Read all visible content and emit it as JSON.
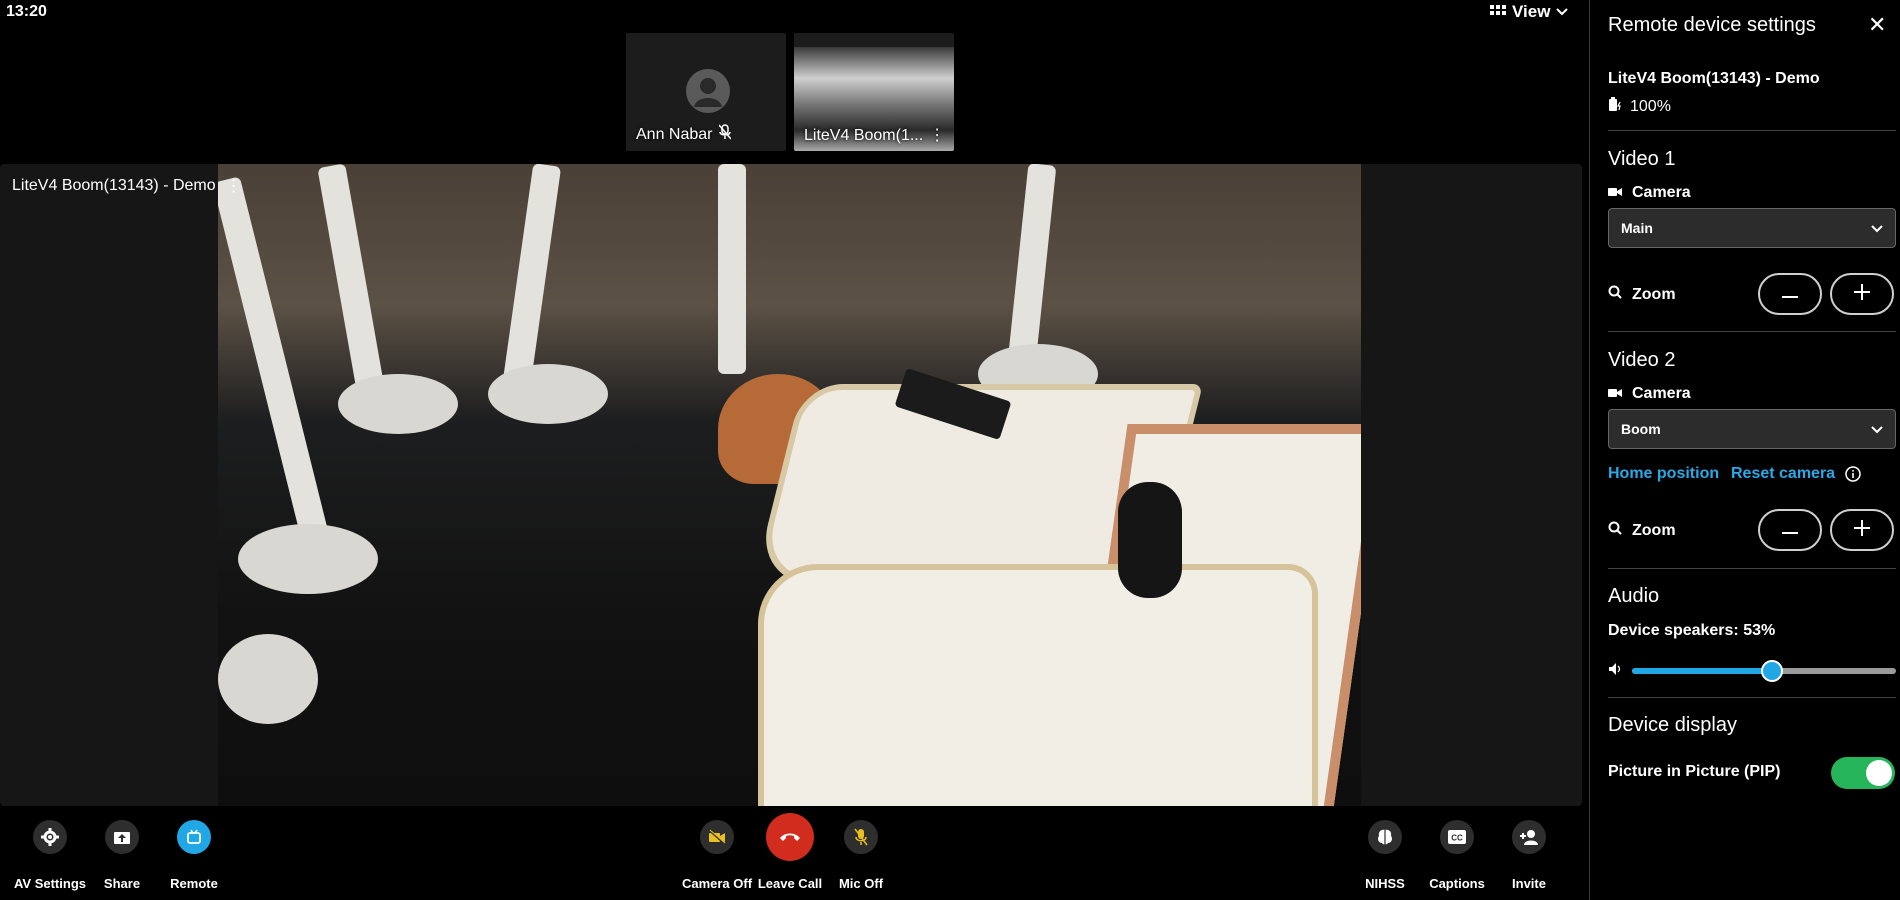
{
  "clock": "13:20",
  "view": {
    "label": "View"
  },
  "thumbnails": [
    {
      "name": "Ann Nabar",
      "muted": true
    },
    {
      "name": "LiteV4 Boom(1..."
    }
  ],
  "stage": {
    "label": "LiteV4 Boom(13143) - Demo"
  },
  "toolbar": {
    "left": [
      {
        "label": "AV Settings",
        "icon": "gear-icon"
      },
      {
        "label": "Share",
        "icon": "share-icon"
      },
      {
        "label": "Remote",
        "icon": "remote-icon",
        "active": true
      }
    ],
    "center": [
      {
        "label": "Camera Off",
        "icon": "camera-off-icon"
      },
      {
        "label": "Leave Call",
        "icon": "phone-hangup-icon"
      },
      {
        "label": "Mic Off",
        "icon": "mic-off-icon"
      }
    ],
    "right": [
      {
        "label": "NIHSS",
        "icon": "brain-icon"
      },
      {
        "label": "Captions",
        "icon": "cc-icon"
      },
      {
        "label": "Invite",
        "icon": "add-person-icon"
      }
    ]
  },
  "panel": {
    "title": "Remote device settings",
    "device_name": "LiteV4 Boom(13143) - Demo",
    "battery": "100%",
    "video1": {
      "title": "Video 1",
      "camera_label": "Camera",
      "camera_value": "Main",
      "zoom_label": "Zoom"
    },
    "video2": {
      "title": "Video 2",
      "camera_label": "Camera",
      "camera_value": "Boom",
      "home_position": "Home position",
      "reset_camera": "Reset camera",
      "zoom_label": "Zoom"
    },
    "audio": {
      "title": "Audio",
      "speakers_label": "Device speakers: 53%",
      "speakers_level": 0.53
    },
    "display": {
      "title": "Device display",
      "pip_label": "Picture in Picture (PIP)",
      "pip_on": true
    }
  },
  "colors": {
    "accent": "#22a7e6",
    "danger": "#d22c1f",
    "toggle_on": "#27b55b",
    "link": "#29a9e8"
  }
}
